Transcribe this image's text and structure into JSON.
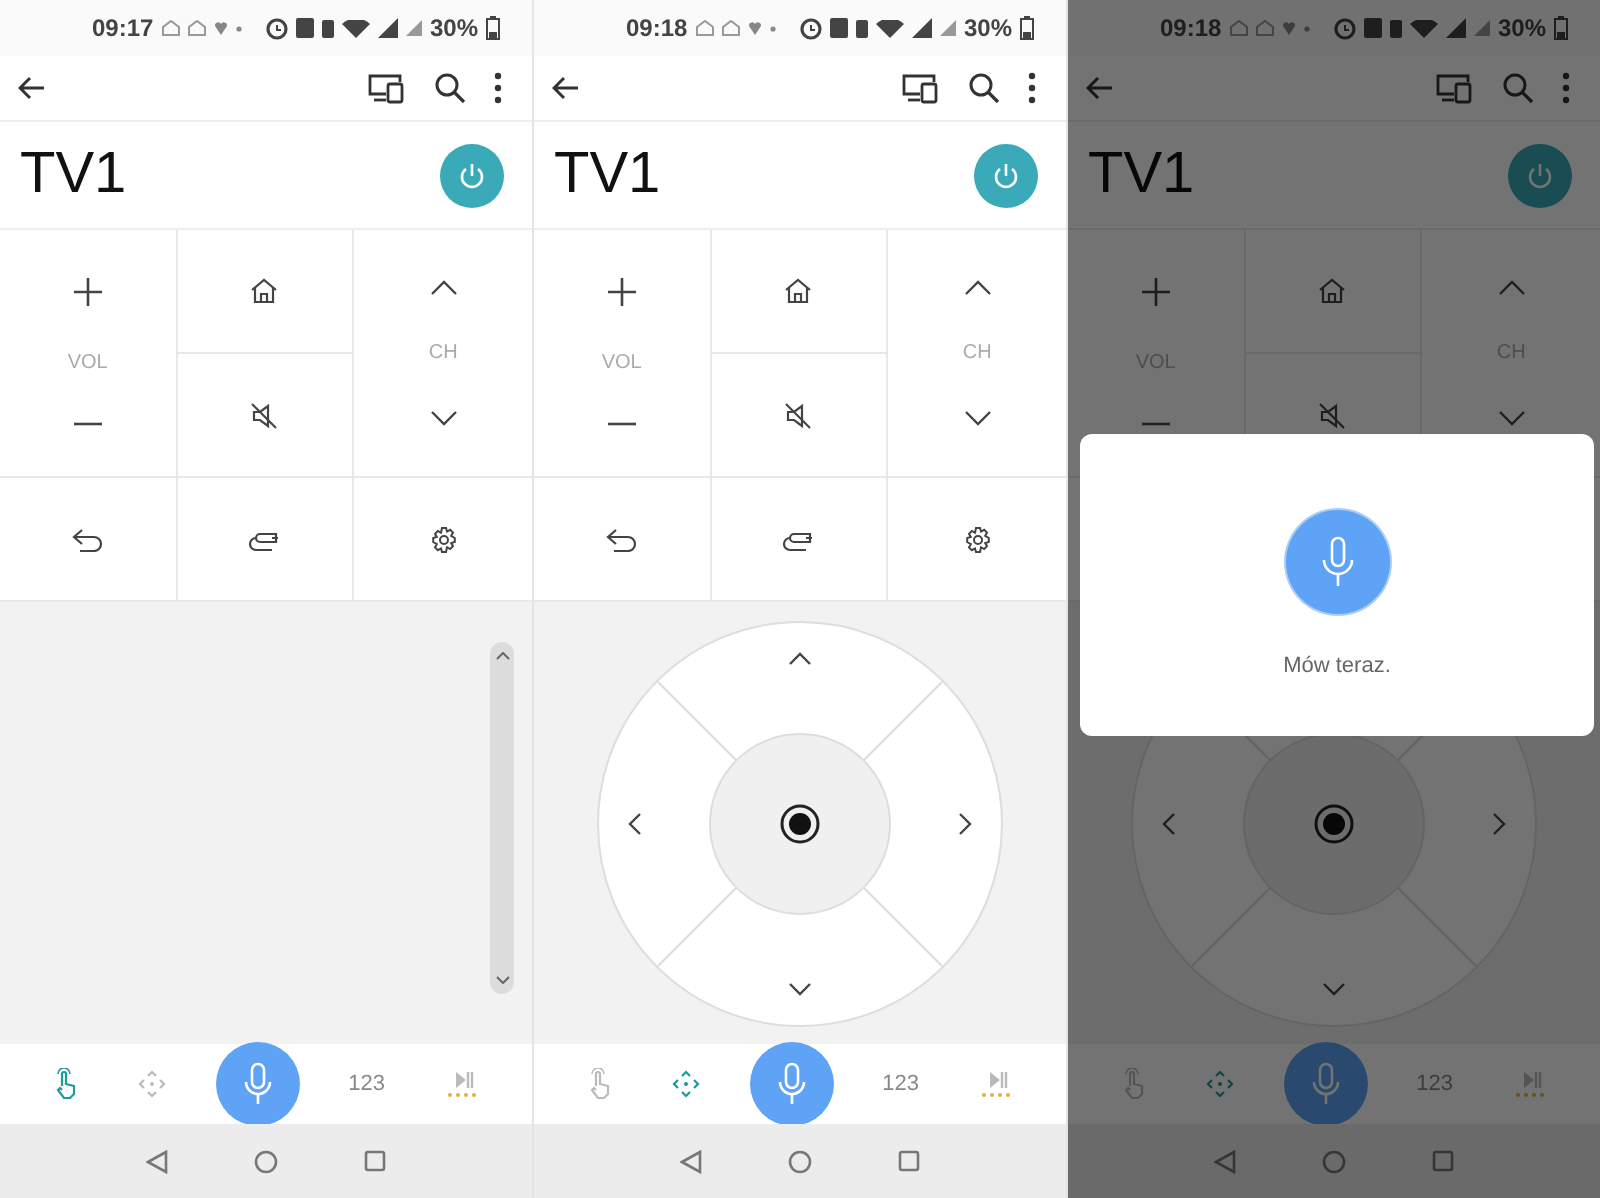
{
  "screens": [
    {
      "status_bar": {
        "time": "09:17",
        "battery": "30%"
      },
      "title": "TV1",
      "keypad": {
        "vol_label": "VOL",
        "ch_label": "CH"
      },
      "content": {
        "kind": "touchpad"
      },
      "tabs": [
        {
          "kind": "touchpad",
          "selected": true
        },
        {
          "kind": "dpad",
          "selected": false
        },
        {
          "kind": "mic",
          "selected": false
        },
        {
          "kind": "numbers",
          "label": "123",
          "selected": false
        },
        {
          "kind": "media",
          "selected": false
        }
      ]
    },
    {
      "status_bar": {
        "time": "09:18",
        "battery": "30%"
      },
      "title": "TV1",
      "keypad": {
        "vol_label": "VOL",
        "ch_label": "CH"
      },
      "content": {
        "kind": "dpad"
      },
      "tabs": [
        {
          "kind": "touchpad",
          "selected": false
        },
        {
          "kind": "dpad",
          "selected": true
        },
        {
          "kind": "mic",
          "selected": false
        },
        {
          "kind": "numbers",
          "label": "123",
          "selected": false
        },
        {
          "kind": "media",
          "selected": false
        }
      ]
    },
    {
      "status_bar": {
        "time": "09:18",
        "battery": "30%"
      },
      "title": "TV1",
      "keypad": {
        "vol_label": "VOL",
        "ch_label": "CH"
      },
      "content": {
        "kind": "dpad"
      },
      "tabs": [
        {
          "kind": "touchpad",
          "selected": false
        },
        {
          "kind": "dpad",
          "selected": true
        },
        {
          "kind": "mic",
          "selected": false
        },
        {
          "kind": "numbers",
          "label": "123",
          "selected": false
        },
        {
          "kind": "media",
          "selected": false
        }
      ],
      "voice_dialog": {
        "message": "Mów teraz."
      }
    }
  ]
}
